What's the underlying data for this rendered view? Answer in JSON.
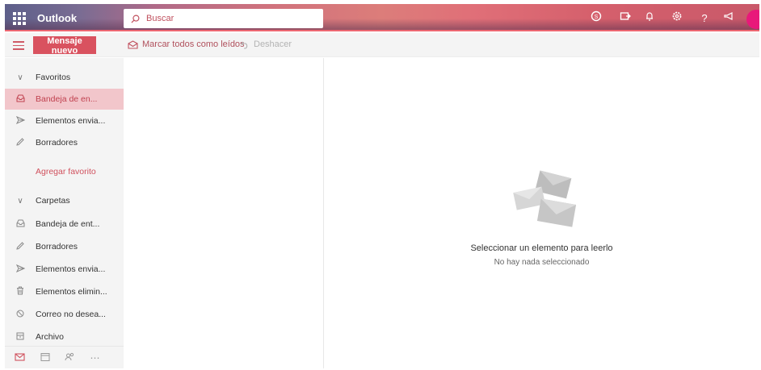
{
  "app": {
    "title": "Outlook"
  },
  "search": {
    "placeholder": "Buscar"
  },
  "header_icons": [
    "skype-icon",
    "forward-icon",
    "bell-icon",
    "gear-icon",
    "help-icon",
    "megaphone-icon"
  ],
  "toolbar": {
    "new_mail_label": "Mensaje nuevo",
    "mark_all_read_label": "Marcar todos como leídos",
    "undo_label": "Deshacer"
  },
  "nav": {
    "favorites_header": "Favoritos",
    "favorites": [
      {
        "label": "Bandeja de en...",
        "icon": "inbox-icon",
        "selected": true
      },
      {
        "label": "Elementos envia...",
        "icon": "sent-icon",
        "selected": false
      },
      {
        "label": "Borradores",
        "icon": "pencil-icon",
        "selected": false
      }
    ],
    "add_favorite_label": "Agregar favorito",
    "folders_header": "Carpetas",
    "folders": [
      {
        "label": "Bandeja de ent...",
        "icon": "inbox-icon"
      },
      {
        "label": "Borradores",
        "icon": "pencil-icon"
      },
      {
        "label": "Elementos envia...",
        "icon": "sent-icon"
      },
      {
        "label": "Elementos elimin...",
        "icon": "trash-icon"
      },
      {
        "label": "Correo no desea...",
        "icon": "block-icon"
      },
      {
        "label": "Archivo",
        "icon": "archive-icon"
      }
    ],
    "bottom": [
      "mail-icon",
      "calendar-icon",
      "people-icon",
      "more-icon"
    ]
  },
  "reading_pane": {
    "empty_title": "Seleccionar un elemento para leerlo",
    "empty_subtitle": "No hay nada seleccionado"
  },
  "colors": {
    "accent": "#d9525f",
    "selected_bg": "#f2c6cb",
    "nav_bg": "#f4f4f4",
    "avatar": "#e8197a"
  }
}
